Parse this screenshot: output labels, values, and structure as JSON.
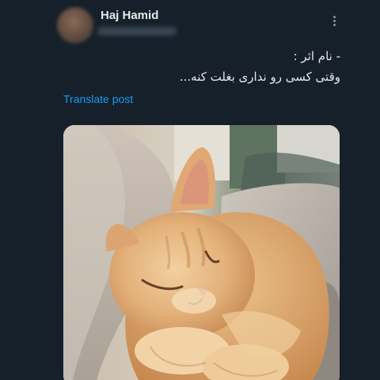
{
  "post": {
    "author_name": "Haj Hamid",
    "text_line_1": "- نام اثر :",
    "text_line_2": "وقتی کسی رو نداری بغلت کنه...",
    "translate_label": "Translate post",
    "more_icon": "more-vertical-icon"
  },
  "media": {
    "subject": "cat-photo"
  }
}
